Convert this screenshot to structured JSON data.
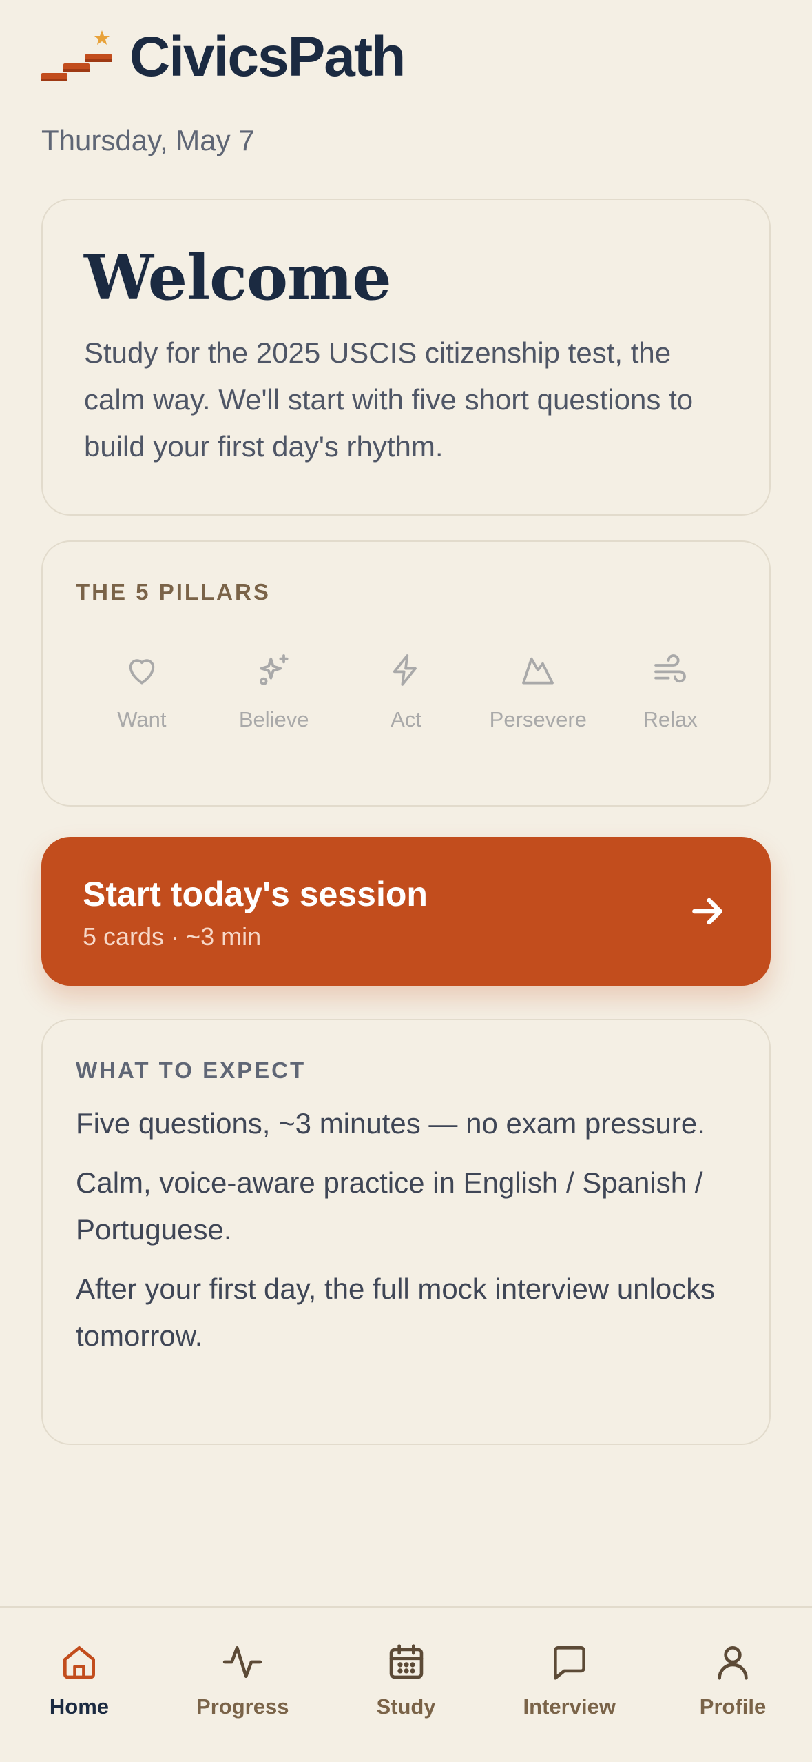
{
  "app": {
    "brand": "CivicsPath",
    "date": "Thursday, May 7"
  },
  "welcome": {
    "title": "Welcome",
    "body": "Study for the 2025 USCIS citizenship test, the calm way. We'll start with five short questions to build your first day's rhythm."
  },
  "pillars": {
    "label": "THE 5 PILLARS",
    "items": [
      {
        "label": "Want",
        "icon": "heart-icon"
      },
      {
        "label": "Believe",
        "icon": "sparkle-icon"
      },
      {
        "label": "Act",
        "icon": "lightning-icon"
      },
      {
        "label": "Persevere",
        "icon": "mountain-icon"
      },
      {
        "label": "Relax",
        "icon": "wind-icon"
      }
    ]
  },
  "cta": {
    "title": "Start today's session",
    "subtitle": "5 cards · ~3 min",
    "icon": "arrow-right-icon"
  },
  "expect": {
    "label": "WHAT TO EXPECT",
    "items": [
      "Five questions, ~3 minutes — no exam pressure.",
      "Calm, voice-aware practice in English / Spanish / Portuguese.",
      "After your first day, the full mock interview unlocks tomorrow."
    ]
  },
  "nav": {
    "active": "Home",
    "tabs": [
      {
        "label": "Home",
        "icon": "home-icon"
      },
      {
        "label": "Progress",
        "icon": "activity-icon"
      },
      {
        "label": "Study",
        "icon": "calendar-icon"
      },
      {
        "label": "Interview",
        "icon": "chat-bubble-icon"
      },
      {
        "label": "Profile",
        "icon": "user-icon"
      }
    ]
  },
  "colors": {
    "background": "#F4EFE4",
    "accent": "#C24D1D",
    "navy": "#1B2A41",
    "star": "#E8A23A",
    "muted": "#A9A9A9",
    "brown": "#7A6348"
  }
}
